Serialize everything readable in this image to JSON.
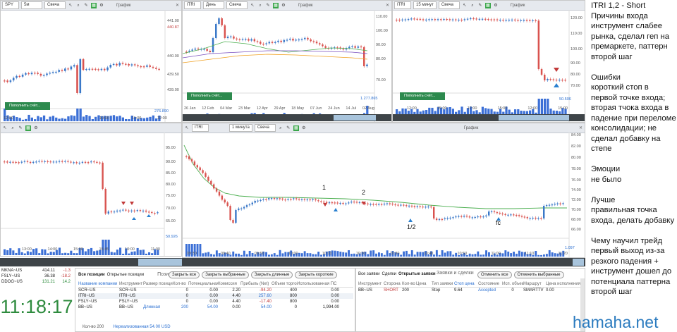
{
  "panes": {
    "spy": {
      "symbol": "SPY",
      "interval": "5м",
      "type": "Свеча",
      "title": "График",
      "y_ticks": [
        "441.00",
        "440.87",
        "440.00",
        "439.50",
        "439.00"
      ],
      "x_ticks": [
        "12:00",
        "10:00",
        "11:00",
        "12:00"
      ],
      "volume_tick": "276.890",
      "fund_button": "Пополнить счёт..."
    },
    "itri_day": {
      "symbol": "ITRI",
      "interval": "День",
      "type": "Свеча",
      "title": "График",
      "y_ticks": [
        "110.00",
        "100.00",
        "90.00",
        "80.00",
        "70.00"
      ],
      "x_ticks": [
        "26 Jan",
        "12 Feb",
        "04 Mar",
        "23 Mar",
        "12 Apr",
        "29 Apr",
        "18 May",
        "07 Jun",
        "24 Jun",
        "14 Jul",
        "02 Aug"
      ],
      "volume_tick": "1.277.865",
      "fund_button": "Пополнить счёт..."
    },
    "itri_15": {
      "symbol": "ITRI",
      "interval": "15 минут",
      "type": "Свеча",
      "title": "График",
      "y_ticks": [
        "120.00",
        "110.00",
        "100.00",
        "90.00",
        "80.00",
        "70.00"
      ],
      "x_ticks": [
        "12:00",
        "15:00",
        "12:00",
        "15:00",
        "12:00",
        "15:00"
      ],
      "volume_tick": "50.506",
      "fund_button": "Пополнить счёт..."
    },
    "left_mid": {
      "y_ticks": [
        "95.00",
        "90.00",
        "85.00",
        "80.00",
        "75.00",
        "70.00",
        "65.00"
      ],
      "x_ticks": [
        "13:00",
        "14:00",
        "15:00",
        "15:45",
        "10:00",
        "11:00"
      ],
      "volume_tick": "50.926"
    },
    "itri_1m": {
      "symbol": "ITRI",
      "interval": "1 минута",
      "type": "Свеча",
      "title": "График",
      "y_ticks": [
        "84.00",
        "82.00",
        "80.00",
        "78.00",
        "76.00",
        "74.00",
        "72.00",
        "70.00",
        "68.00",
        "66.00"
      ],
      "x_ticks": [
        "09:30",
        "09:40",
        "09:50",
        "10:00",
        "10:10",
        "10:20",
        "10:30",
        "10:40",
        "10:50",
        "11:00",
        "11:10",
        "11:20"
      ],
      "volume_tick": "1.097",
      "annotations": {
        "a1": "1",
        "a2": "2",
        "a12": "1/2",
        "fc": "fc"
      }
    }
  },
  "quotes": [
    {
      "symbol": "MKNA~US",
      "last": "414.11",
      "change": "-1.3"
    },
    {
      "symbol": "FSLY~US",
      "last": "36.38",
      "change": "-18.2"
    },
    {
      "symbol": "DDOG~US",
      "last": "131.21",
      "change": "14.2"
    }
  ],
  "clock": "11:18:17",
  "positions": {
    "tabs": [
      "Все позиции",
      "Открытые позиции",
      "Позиции"
    ],
    "buttons": [
      "Закрыть все",
      "Закрыть выбранные",
      "Закрыть длинные",
      "Закрыть короткие"
    ],
    "columns": [
      "Название компании",
      "Инструмент",
      "Размер позиции",
      "Кол-во",
      "Потенциальная",
      "Комиссия",
      "Прибыль (Net)",
      "Объем торгов",
      "Использованная ПС"
    ],
    "rows": [
      [
        "SCR~US",
        "SCR~US",
        "",
        "0",
        "0.00",
        "2.20",
        "-94.20",
        "400",
        "0.00"
      ],
      [
        "ITRI~US",
        "ITRI~US",
        "",
        "0",
        "0.00",
        "4.40",
        "257.60",
        "800",
        "0.00"
      ],
      [
        "FSLY~US",
        "FSLY~US",
        "",
        "0",
        "0.00",
        "4.40",
        "-17.40",
        "800",
        "0.00"
      ],
      [
        "BB~US",
        "BB~US",
        "Длинная",
        "200",
        "54.00",
        "0.00",
        "54.00",
        "0",
        "1,994.00"
      ]
    ],
    "footer_qty": "Кол-во 200",
    "footer_unrealized": "Нереализованная 54.00 USD"
  },
  "orders": {
    "tabs": [
      "Все заявки",
      "Сделки",
      "Открытые заявки"
    ],
    "subtitle": "Заявки и сделки",
    "buttons": [
      "Отменить все",
      "Отменить выбранные"
    ],
    "columns": [
      "Инструмент",
      "Сторона",
      "Кол-во",
      "Цена",
      "Тип заявки",
      "Стоп цена",
      "Состояние",
      "Исп. объем",
      "Маршрут",
      "Цена исполнения"
    ],
    "rows": [
      [
        "BB~US",
        "SHORT",
        "200",
        "",
        "Stop",
        "9.64",
        "Accepted",
        "0",
        "SMARTTV",
        "0.00"
      ]
    ]
  },
  "notes": [
    "ITRI 1,2 - Short\nПричины входа\nинструмент слабее\nрынка, сделал геп на\nпремаркете, паттерн\nвторой шаг",
    "Ошибки\nкороткий стоп в\nпервой точке входа;\nвторая тчока входа в\nпадение при переломе\nконсолидации; не\nсделал добавку на\nстепе",
    "Эмоции\nне было",
    "Лучше\nправильная точка\nвхода, делать добавку",
    "Чему научил  трейд\nпервый выход из-за\nрезкого падения +\nинструмент дошел до\nпотенциала паттерна\nвторой шаг"
  ],
  "brand": "hamaha.net",
  "colors": {
    "up": "#3a78c8",
    "down": "#d9534f",
    "ma": "#4caf50",
    "ma2": "#f0a020",
    "fund": "#2d8a4e",
    "clock": "#2e8b3e"
  }
}
